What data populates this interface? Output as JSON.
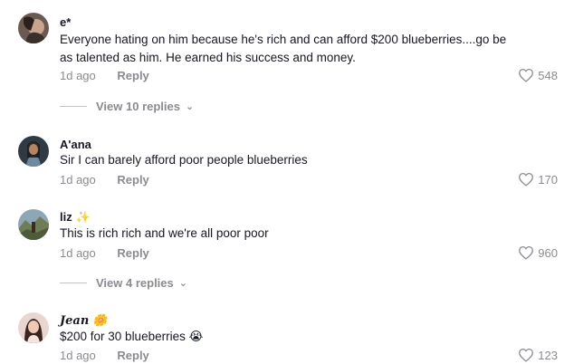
{
  "comments": [
    {
      "username": "e*",
      "badge": "",
      "text": "Everyone hating on him because he's rich and can afford $200 blueberries....go be as talented as him. He earned his success and money.",
      "time": "1d ago",
      "reply_label": "Reply",
      "likes": "548",
      "view_replies": "View 10 replies"
    },
    {
      "username": "A'ana",
      "badge": "",
      "text": "Sir I can barely afford poor people blueberries",
      "time": "1d ago",
      "reply_label": "Reply",
      "likes": "170"
    },
    {
      "username": "liz",
      "badge": "✨",
      "text": "This is rich rich and we're all poor poor",
      "time": "1d ago",
      "reply_label": "Reply",
      "likes": "960",
      "view_replies": "View 4 replies"
    },
    {
      "username": "Jean",
      "badge": "🌼",
      "text": "$200 for 30 blueberries 😭",
      "time": "1d ago",
      "reply_label": "Reply",
      "likes": "123"
    }
  ],
  "icons": {
    "like": "heart-outline-icon",
    "chevron": "chevron-down-icon"
  }
}
